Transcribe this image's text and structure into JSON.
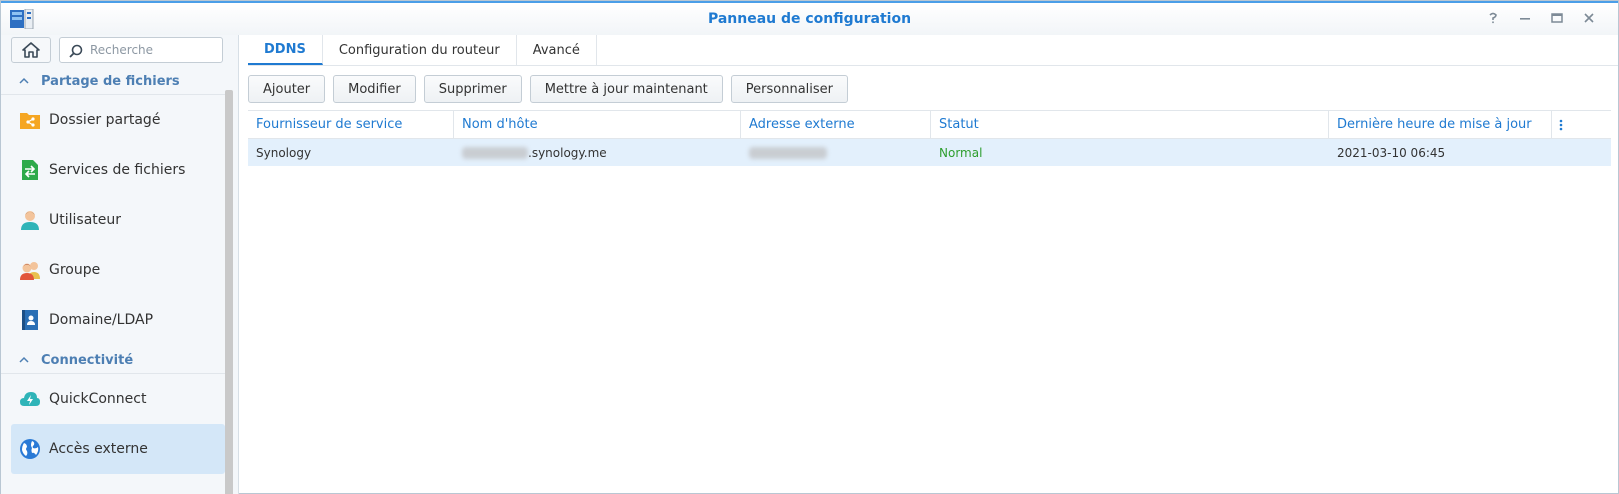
{
  "window": {
    "title": "Panneau de configuration",
    "accent": "#1f7ad1"
  },
  "sidebar": {
    "search_placeholder": "Recherche",
    "sections": [
      {
        "label": "Partage de fichiers",
        "items": [
          {
            "label": "Dossier partagé",
            "icon": "shared-folder-icon"
          },
          {
            "label": "Services de fichiers",
            "icon": "file-services-icon"
          },
          {
            "label": "Utilisateur",
            "icon": "user-icon"
          },
          {
            "label": "Groupe",
            "icon": "group-icon"
          },
          {
            "label": "Domaine/LDAP",
            "icon": "domain-icon"
          }
        ]
      },
      {
        "label": "Connectivité",
        "items": [
          {
            "label": "QuickConnect",
            "icon": "quickconnect-icon"
          },
          {
            "label": "Accès externe",
            "icon": "globe-icon",
            "active": true
          }
        ]
      }
    ]
  },
  "tabs": [
    {
      "label": "DDNS",
      "active": true
    },
    {
      "label": "Configuration du routeur"
    },
    {
      "label": "Avancé"
    }
  ],
  "toolbar": {
    "add": "Ajouter",
    "edit": "Modifier",
    "delete": "Supprimer",
    "update_now": "Mettre à jour maintenant",
    "customize": "Personnaliser"
  },
  "table": {
    "columns": [
      "Fournisseur de service",
      "Nom d'hôte",
      "Adresse externe",
      "Statut",
      "Dernière heure de mise à jour"
    ],
    "rows": [
      {
        "provider": "Synology",
        "hostname_suffix": ".synology.me",
        "status": "Normal",
        "last_update": "2021-03-10 06:45"
      }
    ]
  },
  "colors": {
    "status_normal": "#2e9e2e",
    "selected_row": "#e3f0fc",
    "sidebar_active": "#d4e7f8"
  }
}
